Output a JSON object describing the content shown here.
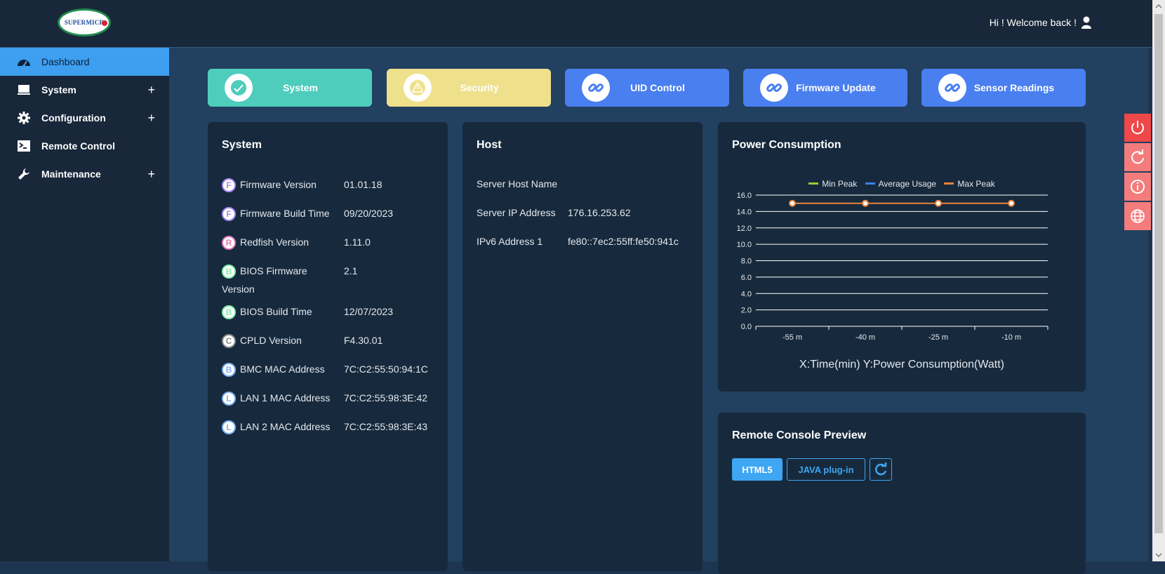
{
  "header": {
    "logo_text": "SUPERMICR",
    "welcome": "Hi ! Welcome back !"
  },
  "sidebar": {
    "items": [
      {
        "label": "Dashboard",
        "icon": "dashboard-gauge-icon",
        "active": true,
        "expandable": false
      },
      {
        "label": "System",
        "icon": "monitor-icon",
        "active": false,
        "expandable": true
      },
      {
        "label": "Configuration",
        "icon": "gear-icon",
        "active": false,
        "expandable": true
      },
      {
        "label": "Remote Control",
        "icon": "terminal-icon",
        "active": false,
        "expandable": false
      },
      {
        "label": "Maintenance",
        "icon": "wrench-icon",
        "active": false,
        "expandable": true
      }
    ],
    "plus": "+"
  },
  "quick_buttons": [
    {
      "label": "System",
      "color": "#4ecdbd",
      "icon": "check-icon"
    },
    {
      "label": "Security",
      "color": "#efe08c",
      "icon": "warning-icon"
    },
    {
      "label": "UID Control",
      "color": "#4a7ff0",
      "icon": "link-icon"
    },
    {
      "label": "Firmware Update",
      "color": "#4a7ff0",
      "icon": "link-icon"
    },
    {
      "label": "Sensor Readings",
      "color": "#4a7ff0",
      "icon": "link-icon"
    }
  ],
  "system_card": {
    "title": "System",
    "rows": [
      {
        "badge": "F",
        "badge_color": "#a78bfa",
        "label": "Firmware Version",
        "value": "01.01.18"
      },
      {
        "badge": "F",
        "badge_color": "#a78bfa",
        "label": "Firmware Build Time",
        "value": "09/20/2023"
      },
      {
        "badge": "R",
        "badge_color": "#e879b9",
        "label": "Redfish Version",
        "value": "1.11.0"
      },
      {
        "badge": "B",
        "badge_color": "#86efac",
        "label": "BIOS Firmware Version",
        "value": "2.1"
      },
      {
        "badge": "B",
        "badge_color": "#86efac",
        "label": "BIOS Build Time",
        "value": "12/07/2023"
      },
      {
        "badge": "C",
        "badge_color": "#8a8a8a",
        "label": "CPLD Version",
        "value": "F4.30.01"
      },
      {
        "badge": "B",
        "badge_color": "#7fb2f5",
        "label": "BMC MAC Address",
        "value": "7C:C2:55:50:94:1C"
      },
      {
        "badge": "L",
        "badge_color": "#7fb2f5",
        "label": "LAN 1 MAC Address",
        "value": "7C:C2:55:98:3E:42"
      },
      {
        "badge": "L",
        "badge_color": "#7fb2f5",
        "label": "LAN 2 MAC Address",
        "value": "7C:C2:55:98:3E:43"
      }
    ]
  },
  "host_card": {
    "title": "Host",
    "rows": [
      {
        "label": "Server Host Name",
        "value": ""
      },
      {
        "label": "Server IP Address",
        "value": "176.16.253.62"
      },
      {
        "label": "IPv6 Address 1",
        "value": "fe80::7ec2:55ff:fe50:941c"
      }
    ]
  },
  "power_card": {
    "title": "Power Consumption",
    "legend": [
      "Min Peak",
      "Average Usage",
      "Max Peak"
    ],
    "caption": "X:Time(min) Y:Power Consumption(Watt)"
  },
  "chart_data": {
    "type": "line",
    "categories": [
      "-55 m",
      "-40 m",
      "-25 m",
      "-10 m"
    ],
    "series": [
      {
        "name": "Min Peak",
        "color": "#9acd32",
        "values": []
      },
      {
        "name": "Average Usage",
        "color": "#3b82f6",
        "values": []
      },
      {
        "name": "Max Peak",
        "color": "#e8823a",
        "values": [
          15,
          15,
          15,
          15
        ]
      }
    ],
    "y_ticks": [
      "16.0",
      "14.0",
      "12.0",
      "10.0",
      "8.0",
      "6.0",
      "4.0",
      "2.0",
      "0.0"
    ],
    "ylim": [
      0,
      16
    ],
    "grid": true,
    "legend_position": "top"
  },
  "console_card": {
    "title": "Remote Console Preview",
    "html5_label": "HTML5",
    "java_label": "JAVA plug-in"
  },
  "side_actions": [
    {
      "icon": "power-icon",
      "color": "#f04848"
    },
    {
      "icon": "refresh-icon",
      "color": "#f47c7c"
    },
    {
      "icon": "info-icon",
      "color": "#f47c7c"
    },
    {
      "icon": "globe-icon",
      "color": "#f47c7c"
    }
  ]
}
